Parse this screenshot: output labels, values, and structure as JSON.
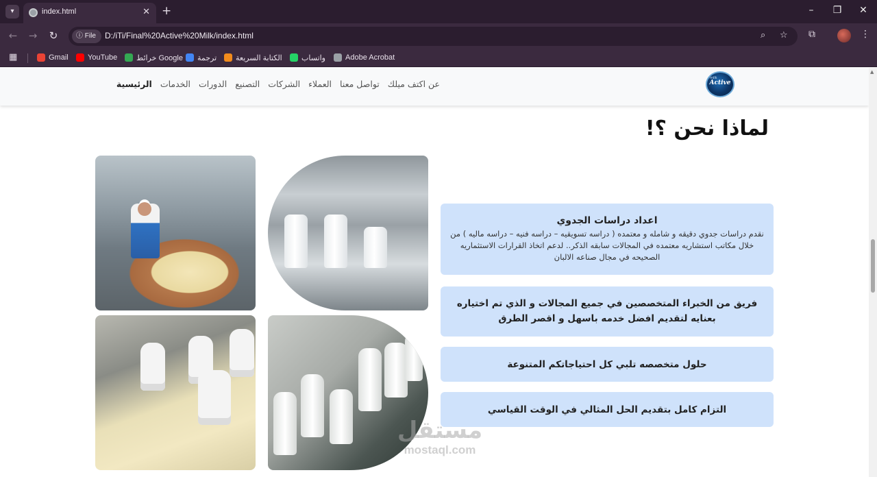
{
  "browser": {
    "tab_title": "index.html",
    "omnibox_chip": "File",
    "url": "D:/iTi/Final%20Active%20Milk/index.html",
    "bookmarks": [
      {
        "label": "Gmail",
        "color": "#ea4335"
      },
      {
        "label": "YouTube",
        "color": "#ff0000"
      },
      {
        "label": "خرائط Google",
        "color": "#34a853"
      },
      {
        "label": "ترجمة",
        "color": "#4285f4"
      },
      {
        "label": "الكتابة السريعة",
        "color": "#f28b1c"
      },
      {
        "label": "واتساب",
        "color": "#25d366"
      },
      {
        "label": "Adobe Acrobat",
        "color": "#9aa0a6"
      }
    ]
  },
  "site": {
    "logo_text": "Active",
    "logo_sub": "milk",
    "nav": [
      {
        "label": "الرئيسية",
        "active": true
      },
      {
        "label": "الخدمات",
        "active": false
      },
      {
        "label": "الدورات",
        "active": false
      },
      {
        "label": "التصنيع",
        "active": false
      },
      {
        "label": "الشركات",
        "active": false
      },
      {
        "label": "العملاء",
        "active": false
      },
      {
        "label": "تواصل معنا",
        "active": false
      },
      {
        "label": "عن اكتف ميلك",
        "active": false
      }
    ]
  },
  "section": {
    "title": "لماذا نحن ؟!",
    "cards": [
      {
        "title": "اعداد دراسات الجدوي",
        "desc": "نقدم دراسات جدوي دقيقه و شامله و معتمده ( دراسه تسويقيه – دراسه فنيه – دراسه ماليه ) من خلال مكاتب استشاريه معتمده في المجالات سابقه الذكر.. لدعم اتخاذ القرارات الاستثماريه الصحيحه في مجال صناعه الالبان"
      },
      {
        "text": "فريق من الخبراء المتخصصين في جميع المجالات و الذي تم اختياره بعنايه لتقديم افضل خدمه باسهل و اقصر الطرق"
      },
      {
        "text": "حلول متخصصه تلبي كل احتياجاتكم المتنوعة"
      },
      {
        "text": "التزام كامل بتقديم الحل المثالي في الوقت القياسي"
      }
    ]
  },
  "watermark": {
    "arabic": "مستقل",
    "latin": "mostaql.com"
  }
}
